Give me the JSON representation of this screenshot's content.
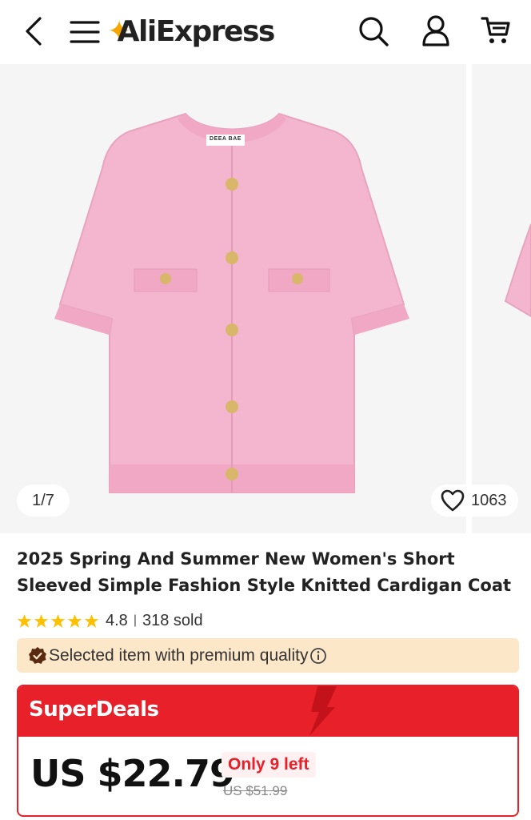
{
  "header": {
    "logo_text": "AliExpress",
    "icons": [
      "back-arrow-icon",
      "menu-icon",
      "search-icon",
      "account-icon",
      "cart-icon"
    ]
  },
  "gallery": {
    "counter": "1/7",
    "favorites_count": "1063",
    "label_text": "DEEA BAE",
    "product_color": "#f4b6cf"
  },
  "product": {
    "title": "2025 Spring And Summer New Women's Short Sleeved Simple Fashion Style Knitted Cardigan Coat",
    "rating": "4.8",
    "sold": "318 sold",
    "rating_stars": 5
  },
  "quality_banner": {
    "text": "Selected item with premium quality",
    "background": "#fde7c9"
  },
  "superdeals": {
    "title": "SuperDeals",
    "price": "US $22.79",
    "stock_note": "Only 9 left",
    "original_price": "US $51.99",
    "accent_color": "#e8202a"
  }
}
